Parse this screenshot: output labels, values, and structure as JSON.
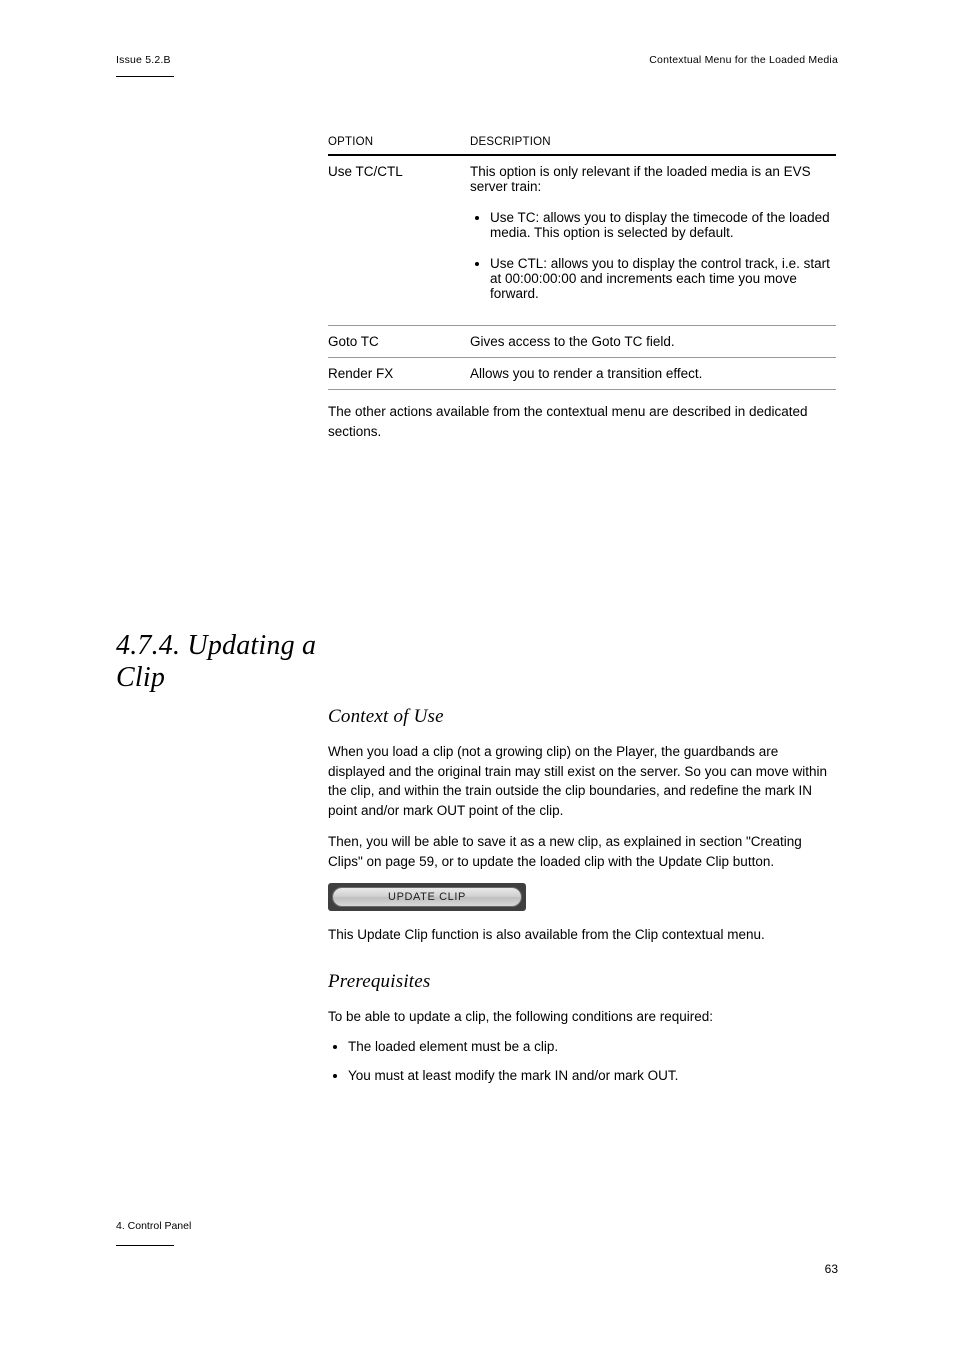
{
  "header": {
    "issue": "Issue 5.2.B",
    "title": "Contextual Menu for the Loaded Media"
  },
  "label_table_header_option": "OPTION",
  "label_table_header_description": "DESCRIPTION",
  "table_rows": [
    {
      "option": "Use TC/CTL",
      "description_intro": "This option is only relevant if the loaded media is an EVS server train:",
      "bullets": [
        "Use TC: allows you to display the timecode of the loaded media. This option is selected by default.",
        "Use CTL: allows you to display the control track, i.e. start at 00:00:00:00 and increments each time you move forward."
      ]
    },
    {
      "option": "Goto TC",
      "description_intro": "Gives access to the Goto TC field.",
      "bullets": []
    },
    {
      "option": "Render FX",
      "description_intro": "Allows you to render a transition effect.",
      "bullets": []
    }
  ],
  "body_paragraphs": {
    "intro_after_table": "The other actions available from the contextual menu are described in dedicated sections.",
    "update_section_heading": "4.7.4. Updating a Clip",
    "context_of_use_heading": "Context of Use",
    "context_p1": "When you load a clip (not a growing clip) on the Player, the guardbands are displayed and the original train may still exist on the server. So you can move within the clip, and within the train outside the clip boundaries, and redefine the mark IN point and/or mark OUT point of the clip.",
    "context_p2": "Then, you will be able to save it as a new clip, as explained in section \"Creating Clips\" on page 59, or to update the loaded clip with the Update Clip button.",
    "context_p3": "This Update Clip function is also available from the Clip contextual menu.",
    "prereq_heading": "Prerequisites",
    "prereq_text": "To be able to update a clip, the following conditions are required:",
    "prereq_bullets": [
      "The loaded element must be a clip.",
      "You must at least modify the mark IN and/or mark OUT."
    ]
  },
  "button_label": "UPDATE CLIP",
  "footer": {
    "chapref": "4. Control Panel",
    "page_number": "63"
  }
}
